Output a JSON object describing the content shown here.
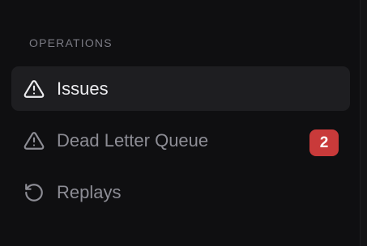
{
  "sidebar": {
    "section_title": "OPERATIONS",
    "items": [
      {
        "label": "Issues",
        "icon": "warning-triangle-icon",
        "active": true
      },
      {
        "label": "Dead Letter Queue",
        "icon": "warning-triangle-icon",
        "badge": "2"
      },
      {
        "label": "Replays",
        "icon": "rotate-ccw-icon"
      }
    ]
  },
  "colors": {
    "background": "#0f0f11",
    "active_item_bg": "#1e1e21",
    "badge": "#c93a3a",
    "text_active": "#ededf0",
    "text_muted": "#8d8d95",
    "section_title": "#7b7b84"
  }
}
